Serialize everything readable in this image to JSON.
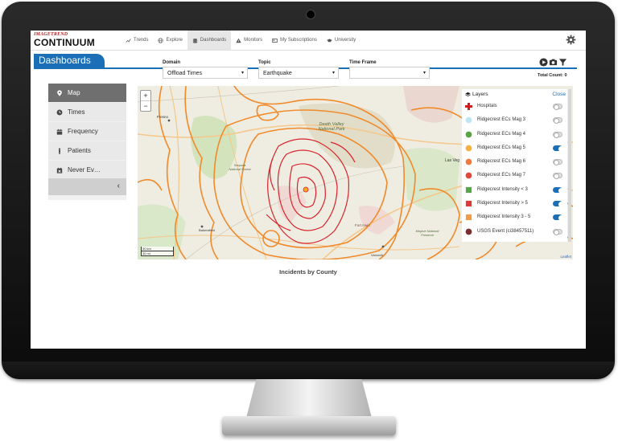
{
  "logo": {
    "small": "IMAGETREND",
    "big": "CONTINUUM"
  },
  "nav": [
    {
      "label": "Trends",
      "icon": "trends-icon"
    },
    {
      "label": "Explore",
      "icon": "globe-icon"
    },
    {
      "label": "Dashboards",
      "icon": "dashboard-icon",
      "active": true
    },
    {
      "label": "Monitors",
      "icon": "warning-icon"
    },
    {
      "label": "My Subscriptions",
      "icon": "subscriptions-icon"
    },
    {
      "label": "University",
      "icon": "graduation-cap-icon"
    }
  ],
  "header": {
    "title": "Dashboards"
  },
  "filters": {
    "domain": {
      "label": "Domain",
      "value": "Offload Times"
    },
    "topic": {
      "label": "Topic",
      "value": "Earthquake"
    },
    "timeframe": {
      "label": "Time Frame",
      "value": ""
    }
  },
  "total_count": "Total Count: 0",
  "sidebar": {
    "items": [
      {
        "label": "Map",
        "icon": "map-pin-icon",
        "active": true
      },
      {
        "label": "Times",
        "icon": "clock-icon"
      },
      {
        "label": "Frequency",
        "icon": "calendar-icon"
      },
      {
        "label": "Patients",
        "icon": "person-icon"
      },
      {
        "label": "Never Ev…",
        "icon": "calendar-x-icon"
      }
    ],
    "collapse": "‹"
  },
  "map": {
    "zoom_in": "+",
    "zoom_out": "−",
    "scale_km": "30 km",
    "scale_mi": "30 mi",
    "attribution": "Leaflet",
    "labels": {
      "death_valley": "Death Valley National Park",
      "fort_irwin": "Fort Irwin",
      "las_vegas": "Las Veg",
      "fresno": "Fresno",
      "sequoia": "Sequoia National Forest",
      "mojave": "Mojave National Preserve",
      "bakersfield": "Bakersfield",
      "victorville": "Victorvill"
    }
  },
  "layers": {
    "title": "Layers",
    "close": "Close",
    "items": [
      {
        "label": "Hospitals",
        "symbol": "red-cross",
        "color": "#d21c1c",
        "on": false
      },
      {
        "label": "Ridgecrest ECs Mag 3",
        "symbol": "circle",
        "color": "#bfe6f2",
        "on": false
      },
      {
        "label": "Ridgecrest ECs Mag 4",
        "symbol": "circle",
        "color": "#5aa445",
        "on": false
      },
      {
        "label": "Ridgecrest ECs Mag 5",
        "symbol": "circle",
        "color": "#f5b040",
        "on": true
      },
      {
        "label": "Ridgecrest ECs Mag 6",
        "symbol": "circle",
        "color": "#f07a3a",
        "on": false
      },
      {
        "label": "Ridgecrest ECs Mag 7",
        "symbol": "circle",
        "color": "#e0483a",
        "on": false
      },
      {
        "label": "Ridgecrest Intensity < 3",
        "symbol": "square",
        "color": "#58a64b",
        "on": true
      },
      {
        "label": "Ridgecrest Intensity > 5",
        "symbol": "square",
        "color": "#e0393a",
        "on": true
      },
      {
        "label": "Ridgecrest Intensity 3 - 5",
        "symbol": "square",
        "color": "#f59a45",
        "on": true
      },
      {
        "label": "USGS Event (ci38457511)",
        "symbol": "circle",
        "color": "#7b2e2e",
        "on": false
      }
    ]
  },
  "caption": "Incidents by County",
  "colors": {
    "accent": "#1a6fb6",
    "contour_orange": "#f08a2a",
    "contour_red": "#d8232a"
  }
}
